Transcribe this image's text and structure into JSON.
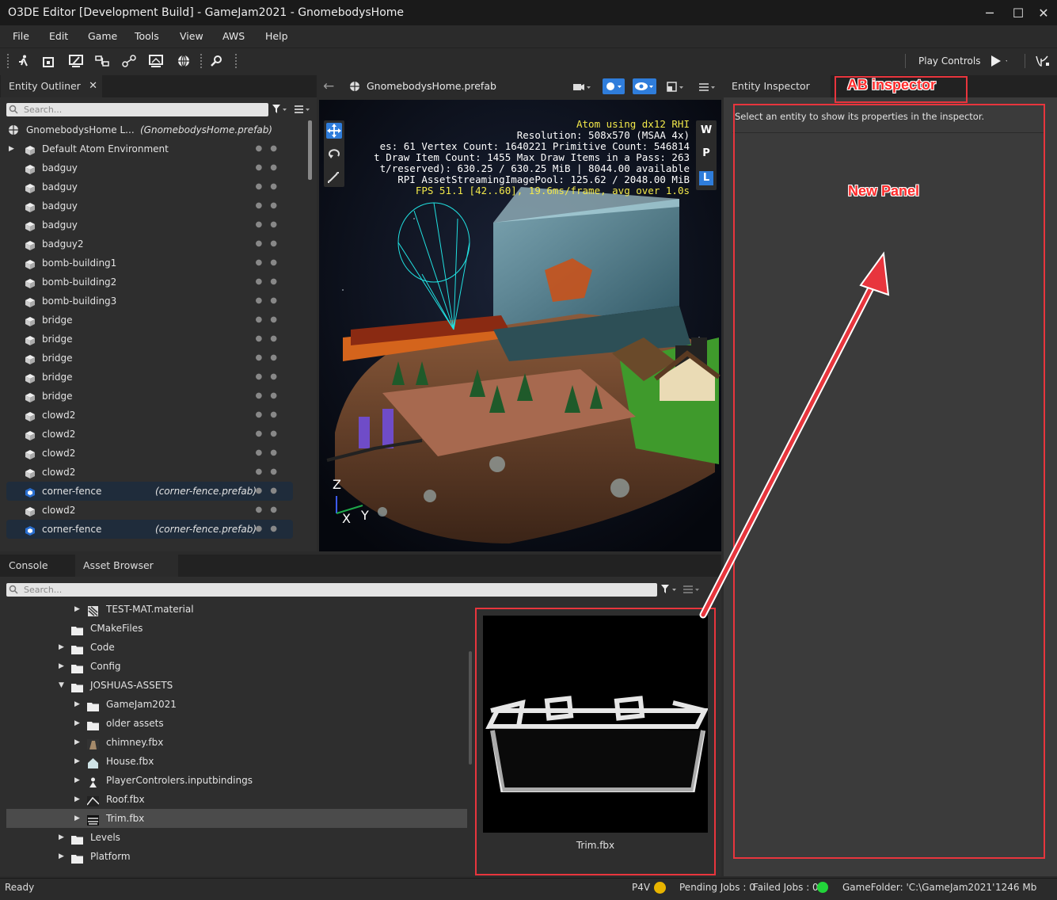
{
  "window": {
    "title": "O3DE Editor [Development Build] - GameJam2021 - GnomebodysHome",
    "minimize": "─",
    "maximize": "☐",
    "close": "✕"
  },
  "menu": [
    "File",
    "Edit",
    "Game",
    "Tools",
    "View",
    "AWS",
    "Help"
  ],
  "toolbar": {
    "play_controls": "Play Controls"
  },
  "outliner": {
    "tab": "Entity Outliner",
    "close": "✕",
    "search_placeholder": "Search...",
    "root": "GnomebodysHome L...",
    "root_prefab": "(GnomebodysHome.prefab)",
    "items": [
      {
        "label": "Default Atom Environment",
        "expand": "▶",
        "prefab": ""
      },
      {
        "label": "badguy",
        "prefab": ""
      },
      {
        "label": "badguy",
        "prefab": ""
      },
      {
        "label": "badguy",
        "prefab": ""
      },
      {
        "label": "badguy",
        "prefab": ""
      },
      {
        "label": "badguy2",
        "prefab": ""
      },
      {
        "label": "bomb-building1",
        "prefab": ""
      },
      {
        "label": "bomb-building2",
        "prefab": ""
      },
      {
        "label": "bomb-building3",
        "prefab": ""
      },
      {
        "label": "bridge",
        "prefab": ""
      },
      {
        "label": "bridge",
        "prefab": ""
      },
      {
        "label": "bridge",
        "prefab": ""
      },
      {
        "label": "bridge",
        "prefab": ""
      },
      {
        "label": "bridge",
        "prefab": ""
      },
      {
        "label": "clowd2",
        "prefab": ""
      },
      {
        "label": "clowd2",
        "prefab": ""
      },
      {
        "label": "clowd2",
        "prefab": ""
      },
      {
        "label": "clowd2",
        "prefab": ""
      },
      {
        "label": "corner-fence",
        "prefab": "(corner-fence.prefab)"
      },
      {
        "label": "clowd2",
        "prefab": ""
      },
      {
        "label": "corner-fence",
        "prefab": "(corner-fence.prefab)"
      }
    ]
  },
  "viewport": {
    "back": "←",
    "tab": "GnomebodysHome.prefab",
    "stats": [
      "Atom using dx12 RHI",
      "Resolution: 508x570 (MSAA 4x)",
      "es: 61 Vertex Count: 1640221 Primitive Count: 546814",
      "t Draw Item Count: 1455  Max Draw Items in a Pass: 263",
      "t/reserved): 630.25 / 630.25 MiB | 8044.00 available",
      "RPI AssetStreamingImagePool: 125.62 / 2048.00 MiB",
      "FPS 51.1 [42..60], 19.6ms/frame, avg over 1.0s"
    ],
    "wpl": [
      "W",
      "P",
      "L"
    ],
    "axis_z": "Z",
    "axis_x": "X",
    "axis_y": "Y"
  },
  "inspector": {
    "tab": "Entity Inspector",
    "message": "Select an entity to show its properties in the inspector."
  },
  "annotations": {
    "ab_inspector": "AB inspector",
    "new_panel": "New Panel"
  },
  "bottom": {
    "tabs": [
      "Console",
      "Asset Browser"
    ],
    "search_placeholder": "Search...",
    "tree": [
      {
        "label": "TEST-MAT.material",
        "depth": 2,
        "expand": "▶",
        "icon": "material"
      },
      {
        "label": "CMakeFiles",
        "depth": 1,
        "expand": "",
        "icon": "folder"
      },
      {
        "label": "Code",
        "depth": 1,
        "expand": "▶",
        "icon": "folder"
      },
      {
        "label": "Config",
        "depth": 1,
        "expand": "▶",
        "icon": "folder"
      },
      {
        "label": "JOSHUAS-ASSETS",
        "depth": 1,
        "expand": "▼",
        "icon": "folder"
      },
      {
        "label": "GameJam2021",
        "depth": 2,
        "expand": "▶",
        "icon": "folder"
      },
      {
        "label": "older assets",
        "depth": 2,
        "expand": "▶",
        "icon": "folder"
      },
      {
        "label": "chimney.fbx",
        "depth": 2,
        "expand": "▶",
        "icon": "chimney"
      },
      {
        "label": "House.fbx",
        "depth": 2,
        "expand": "▶",
        "icon": "house"
      },
      {
        "label": "PlayerControlers.inputbindings",
        "depth": 2,
        "expand": "▶",
        "icon": "person"
      },
      {
        "label": "Roof.fbx",
        "depth": 2,
        "expand": "▶",
        "icon": "roof"
      },
      {
        "label": "Trim.fbx",
        "depth": 2,
        "expand": "▶",
        "icon": "trim",
        "selected": true
      },
      {
        "label": "Levels",
        "depth": 1,
        "expand": "▶",
        "icon": "folder"
      },
      {
        "label": "Platform",
        "depth": 1,
        "expand": "▶",
        "icon": "folder"
      }
    ],
    "preview_label": "Trim.fbx"
  },
  "status": {
    "ready": "Ready",
    "p4v": "P4V",
    "pending": "Pending Jobs : 0",
    "failed": "Failed Jobs : 0",
    "gamefolder": "GameFolder: 'C:\\GameJam2021'",
    "memory": "1246 Mb"
  }
}
